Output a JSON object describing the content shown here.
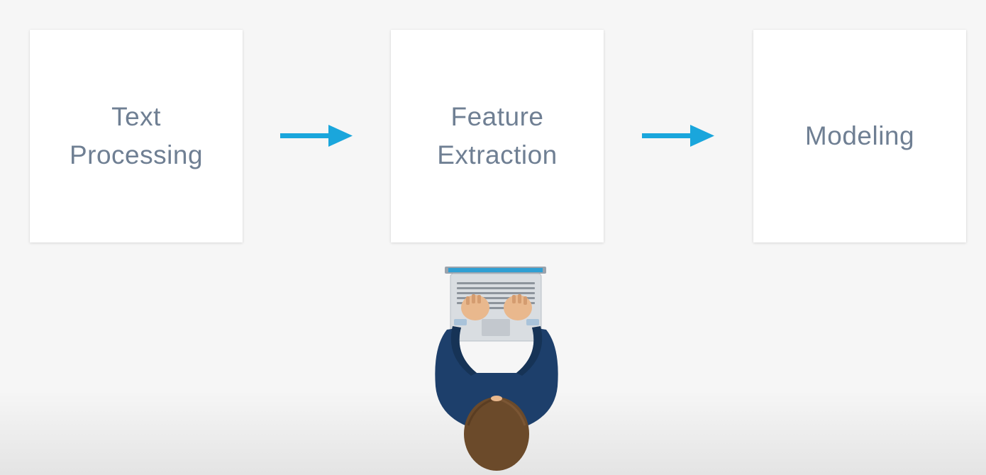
{
  "steps": [
    {
      "label": "Text\nProcessing"
    },
    {
      "label": "Feature\nExtraction"
    },
    {
      "label": "Modeling"
    }
  ],
  "colors": {
    "arrow": "#1aa6dc",
    "label": "#6f7f93",
    "background": "#f6f6f6",
    "shirt": "#1d3f6b",
    "hair": "#6b4a2a"
  }
}
